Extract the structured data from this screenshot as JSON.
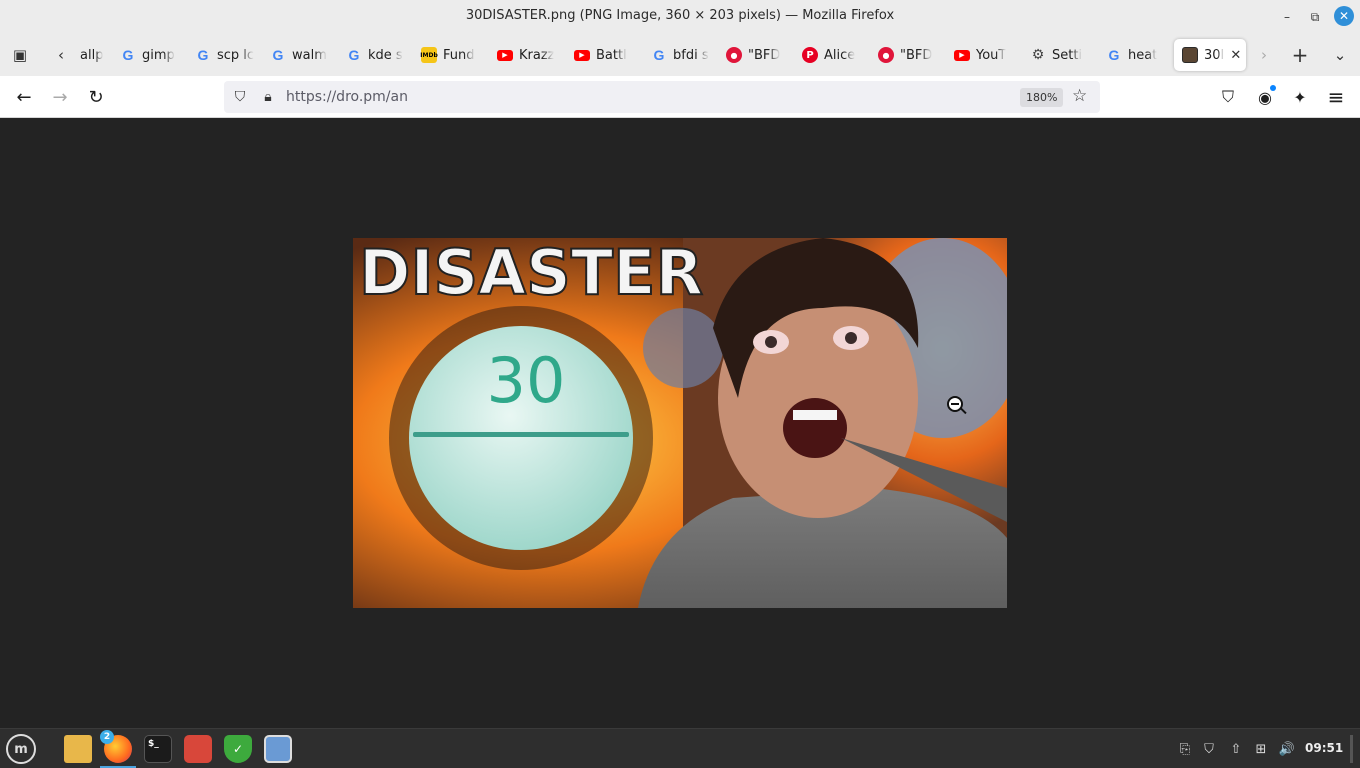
{
  "window": {
    "title": "30DISASTER.png (PNG Image, 360 × 203 pixels) — Mozilla Firefox",
    "controls": {
      "minimize": "–",
      "maximize": "⧉",
      "close": "✕"
    }
  },
  "tabstrip": {
    "list_all_tabs": "▣",
    "scroll_left": "‹",
    "scroll_right": "›",
    "new_tab": "+",
    "list_tabs": "⌄",
    "tabs": [
      {
        "label": "allp",
        "favicon": "",
        "favicon_type": "none"
      },
      {
        "label": "gimp",
        "favicon": "G",
        "favicon_type": "google"
      },
      {
        "label": "scp lc",
        "favicon": "G",
        "favicon_type": "google"
      },
      {
        "label": "walm",
        "favicon": "G",
        "favicon_type": "google"
      },
      {
        "label": "kde s",
        "favicon": "G",
        "favicon_type": "google"
      },
      {
        "label": "Fund",
        "favicon": "IMDb",
        "favicon_type": "imdb"
      },
      {
        "label": "Krazz",
        "favicon": "▶",
        "favicon_type": "youtube"
      },
      {
        "label": "Battl",
        "favicon": "▶",
        "favicon_type": "youtube"
      },
      {
        "label": "bfdi s",
        "favicon": "G",
        "favicon_type": "google"
      },
      {
        "label": "\"BFD",
        "favicon": "●",
        "favicon_type": "red"
      },
      {
        "label": "Alice",
        "favicon": "P",
        "favicon_type": "pinterest"
      },
      {
        "label": "\"BFD",
        "favicon": "●",
        "favicon_type": "red"
      },
      {
        "label": "YouT",
        "favicon": "▶",
        "favicon_type": "youtube"
      },
      {
        "label": "Setti",
        "favicon": "⚙",
        "favicon_type": "gear"
      },
      {
        "label": "heat",
        "favicon": "G",
        "favicon_type": "google"
      },
      {
        "label": "30I",
        "favicon": "",
        "favicon_type": "image",
        "active": true,
        "close": "✕"
      }
    ]
  },
  "navbar": {
    "back": "←",
    "forward": "→",
    "reload": "↻",
    "url": "https://dro.pm/an",
    "zoom": "180%",
    "bookmark_star": "☆",
    "pocket": "⛉",
    "account": "◉",
    "extensions": "✦",
    "menu": "≡"
  },
  "image": {
    "headline": "DISASTER",
    "pill_text": "30"
  },
  "taskbar": {
    "start": "m",
    "apps": [
      {
        "name": "files",
        "glyph": ""
      },
      {
        "name": "firefox",
        "glyph": "",
        "badge": "2"
      },
      {
        "name": "terminal",
        "glyph": "$_"
      },
      {
        "name": "gimp",
        "glyph": ""
      },
      {
        "name": "shield",
        "glyph": "✓"
      },
      {
        "name": "screenshot",
        "glyph": ""
      }
    ],
    "tray": {
      "clipboard": "⎘",
      "shield": "⛉",
      "updates": "⇧",
      "network": "⊞",
      "volume": "🔊"
    },
    "clock": "09:51"
  },
  "colors": {
    "accent": "#2f8fd8",
    "page_background": "#232323",
    "toolbar": "#ececec"
  }
}
